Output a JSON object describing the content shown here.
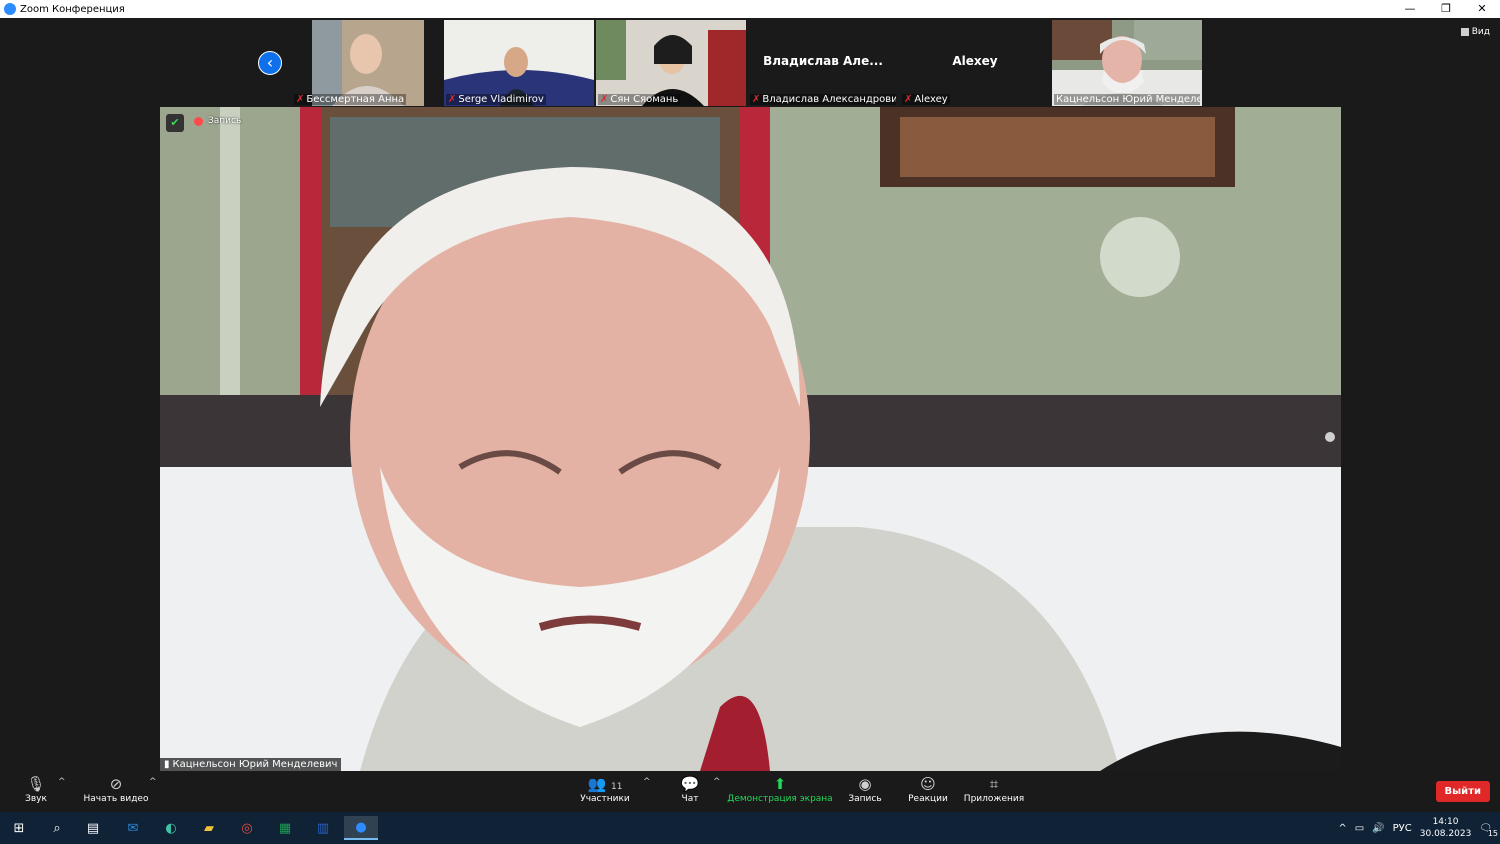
{
  "window": {
    "title": "Zoom Конференция",
    "controls": {
      "minimize": "—",
      "restore": "❐",
      "close": "✕"
    }
  },
  "view_button": {
    "label": "Вид"
  },
  "participants_strip": [
    {
      "name": "Бессмертная Анна",
      "has_video": true,
      "muted": true,
      "active": false,
      "center_name": ""
    },
    {
      "name": "Serge Vladimirov",
      "has_video": true,
      "muted": true,
      "active": false,
      "center_name": ""
    },
    {
      "name": "Сян Сяомань",
      "has_video": true,
      "muted": true,
      "active": false,
      "center_name": ""
    },
    {
      "name": "Владислав Александрович...",
      "has_video": false,
      "muted": true,
      "active": false,
      "center_name": "Владислав Але..."
    },
    {
      "name": "Alexey",
      "has_video": false,
      "muted": true,
      "active": false,
      "center_name": "Alexey"
    },
    {
      "name": "Кацнельсон Юрий Менделев...",
      "has_video": true,
      "muted": false,
      "active": true,
      "center_name": ""
    }
  ],
  "main_video": {
    "recording_label": "Запись",
    "speaker_name": "Кацнельсон Юрий Менделевич"
  },
  "toolbar": {
    "audio_label": "Звук",
    "video_label": "Начать видео",
    "participants_label": "Участники",
    "participants_count": "11",
    "chat_label": "Чат",
    "share_label": "Демонстрация экрана",
    "record_label": "Запись",
    "reactions_label": "Реакции",
    "apps_label": "Приложения",
    "leave_label": "Выйти"
  },
  "taskbar": {
    "language": "РУС",
    "time": "14:10",
    "date": "30.08.2023",
    "notifications": "15"
  },
  "colors": {
    "accent": "#0e71eb",
    "active_speaker": "#23d959",
    "leave": "#e02828",
    "taskbar": "#0f2236"
  }
}
